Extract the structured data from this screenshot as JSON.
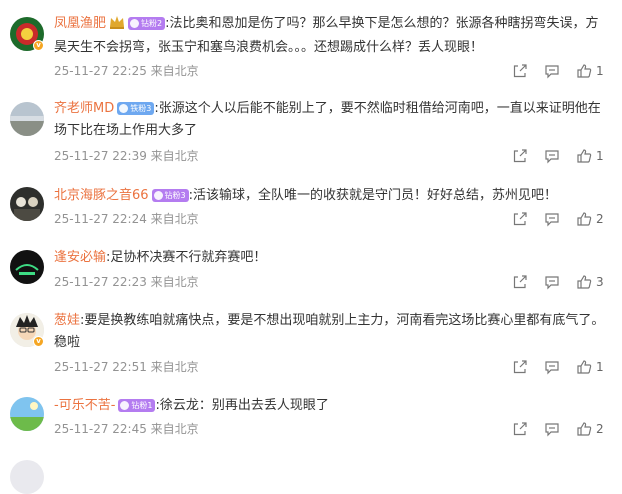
{
  "comments": [
    {
      "username": "凤凰渔肥",
      "has_crown": true,
      "fan_badge": "钻粉2",
      "badge_color": "#b47cf0",
      "text": ":法比奥和恩加是伤了吗？那么早换下是怎么想的？张源各种瞎拐弯失误，方昊天生不会拐弯，张玉宁和塞鸟浪费机会。。。还想踢成什么样？丢人现眼！",
      "meta": "25-11-27 22:25 来自北京",
      "likes": "1"
    },
    {
      "username": "齐老师MD",
      "has_crown": false,
      "fan_badge": "铁粉3",
      "badge_color": "#6ea8f0",
      "text": ":张源这个人以后能不能别上了，要不然临时租借给河南吧，一直以来证明他在场下比在场上作用大多了",
      "meta": "25-11-27 22:39 来自北京",
      "likes": "1"
    },
    {
      "username": "北京海豚之音66",
      "has_crown": false,
      "fan_badge": "钻粉3",
      "badge_color": "#b47cf0",
      "text": ":活该输球，全队唯一的收获就是守门员！好好总结，苏州见吧！",
      "meta": "25-11-27 22:24 来自北京",
      "likes": "2"
    },
    {
      "username": "逢安必输",
      "has_crown": false,
      "fan_badge": "",
      "badge_color": "",
      "text": ":足协杯决赛不行就弃赛吧！",
      "meta": "25-11-27 22:23 来自北京",
      "likes": "3"
    },
    {
      "username": "葱娃",
      "has_crown": false,
      "fan_badge": "",
      "badge_color": "",
      "text": ":要是换教练咱就痛快点，要是不想出现咱就别上主力，河南看完这场比赛心里都有底气了。稳啦",
      "meta": "25-11-27 22:51 来自北京",
      "likes": "1"
    },
    {
      "username": "-可乐不苦-",
      "has_crown": false,
      "fan_badge": "钻粉1",
      "badge_color": "#b47cf0",
      "text": ":徐云龙：别再出去丢人现眼了",
      "meta": "25-11-27 22:45 来自北京",
      "likes": "2"
    }
  ],
  "icons": [
    "share-icon",
    "comment-icon",
    "like-icon"
  ],
  "colors": {
    "username": "#eb7340",
    "meta": "#939393",
    "text": "#333333"
  }
}
